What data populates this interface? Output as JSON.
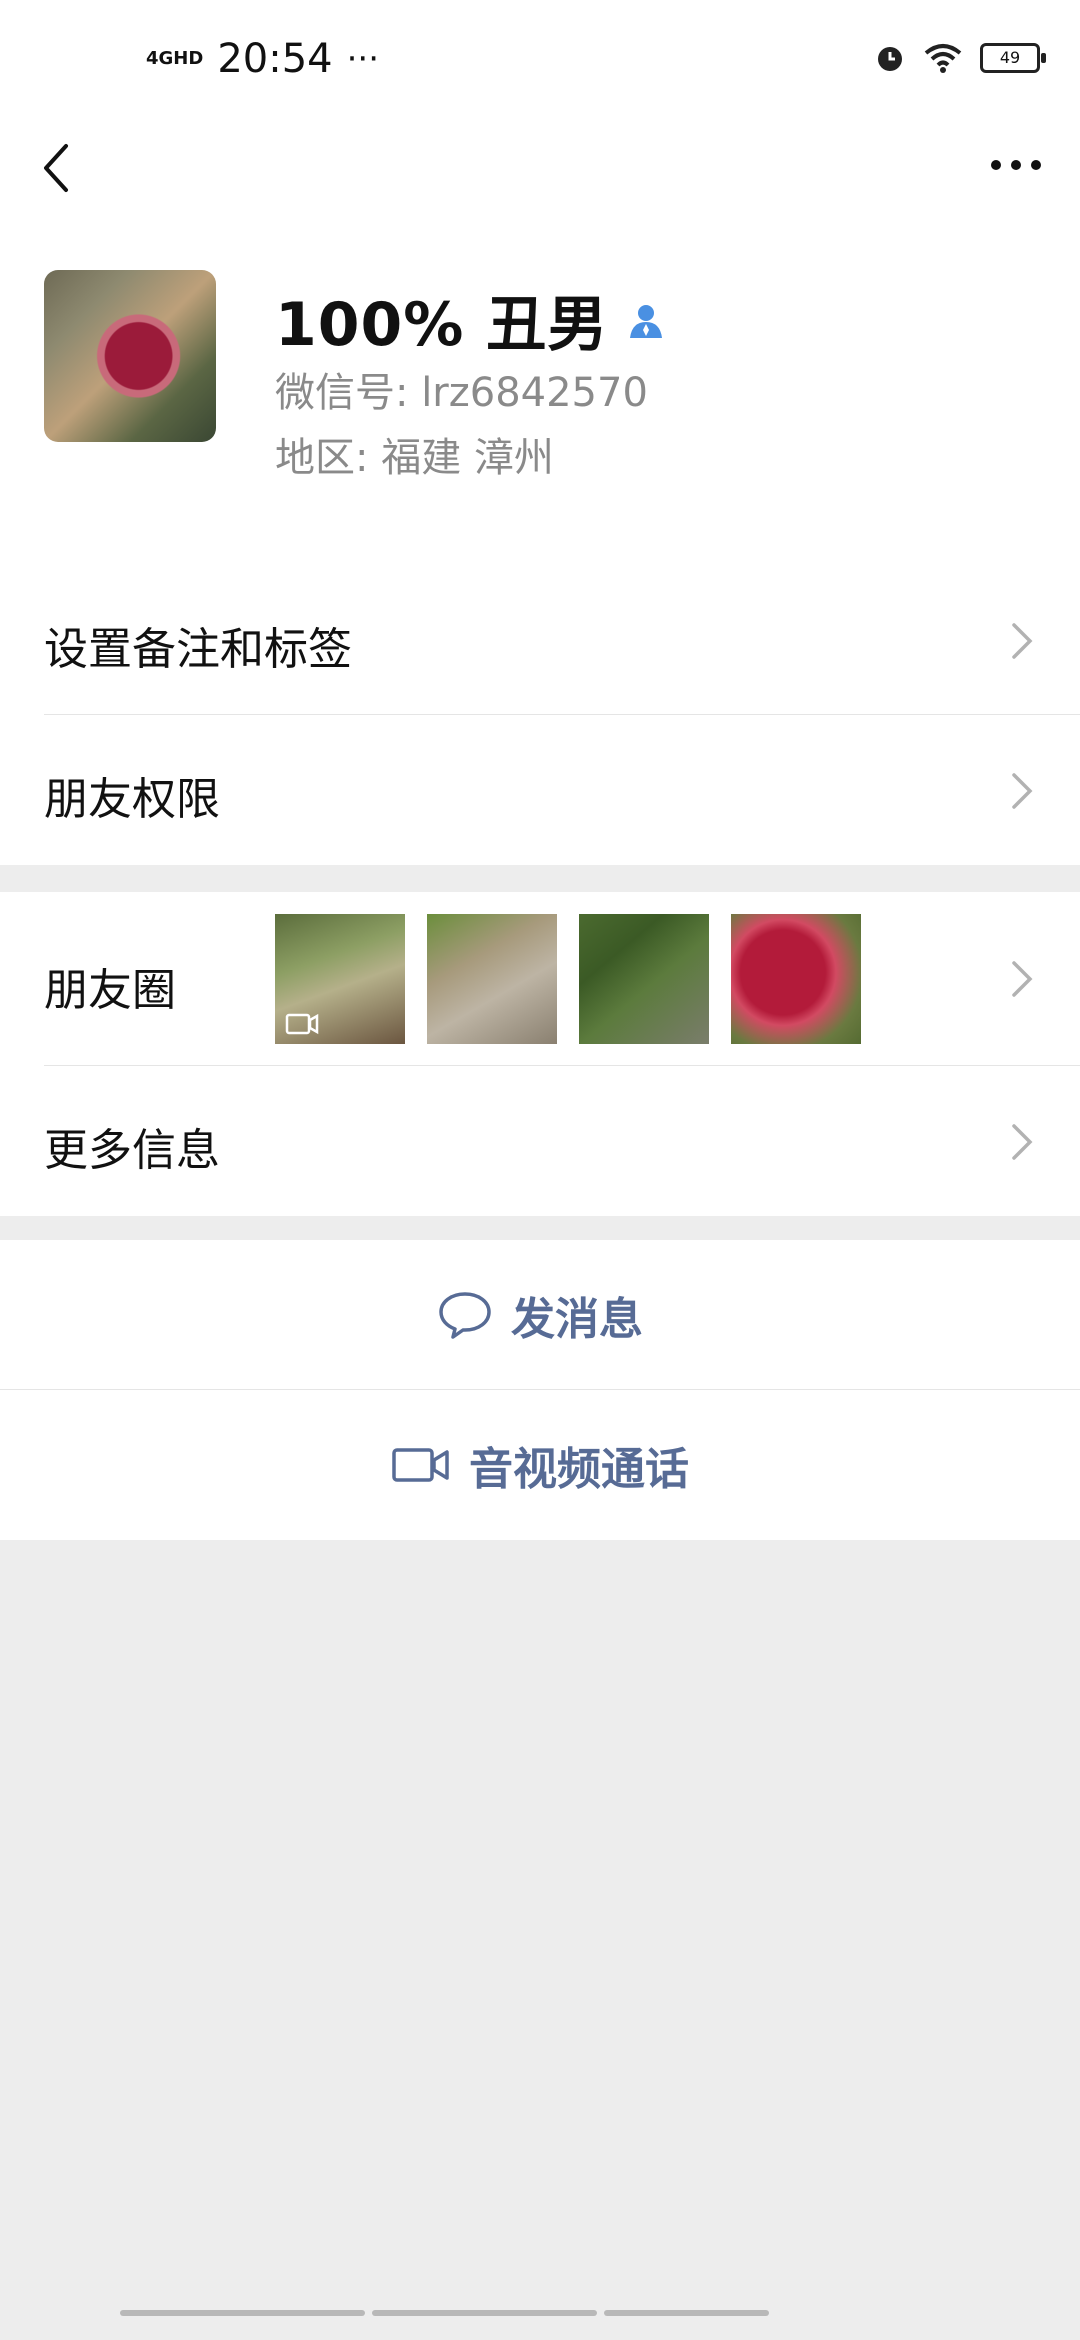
{
  "status_bar": {
    "network": "4GHD",
    "time": "20:54",
    "more": "···",
    "battery": "49"
  },
  "nav": {
    "back_label": "back",
    "more_label": "more"
  },
  "profile": {
    "name": "100% 丑男",
    "wechat_id": "微信号: lrz6842570",
    "region": "地区: 福建  漳州"
  },
  "menu": {
    "remark": "设置备注和标签",
    "permissions": "朋友权限",
    "moments": "朋友圈",
    "more_info": "更多信息"
  },
  "actions": {
    "message": "发消息",
    "call": "音视频通话"
  },
  "colors": {
    "link": "#576b95",
    "bg": "#ededed"
  },
  "icons": [
    "back-icon",
    "more-icon",
    "verified-user-icon",
    "chevron-right-icon",
    "message-bubble-icon",
    "video-camera-icon",
    "alarm-icon",
    "wifi-icon",
    "battery-icon"
  ]
}
